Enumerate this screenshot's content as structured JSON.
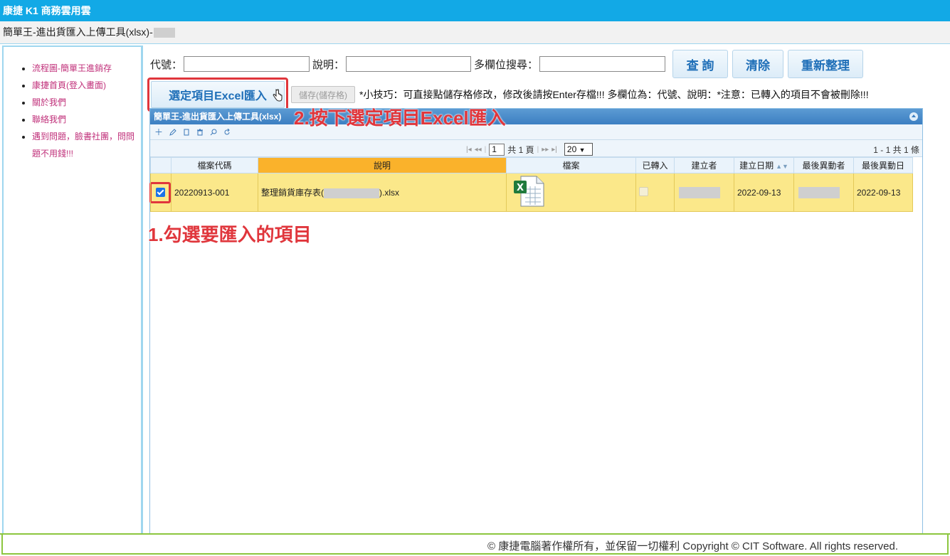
{
  "app": {
    "title": "康捷 K1 商務雲用雲"
  },
  "page": {
    "subtitle": "簡單王-進出貨匯入上傳工具(xlsx)-"
  },
  "sidebar": {
    "items": [
      {
        "label": "流程圖-簡單王進銷存"
      },
      {
        "label": "康捷首頁(登入畫面)"
      },
      {
        "label": "關於我們"
      },
      {
        "label": "聯絡我們"
      },
      {
        "label": "遇到問題，臉書社團，問問題不用錢!!!"
      }
    ]
  },
  "search": {
    "code_label": "代號：",
    "code_value": "",
    "desc_label": "說明：",
    "desc_value": "",
    "multi_label": "多欄位搜尋：",
    "multi_value": "",
    "query_button": "查 詢",
    "clear_button": "清除",
    "refresh_button": "重新整理"
  },
  "actions": {
    "excel_import_button": "選定項目Excel匯入",
    "save_button": "儲存(儲存格)",
    "tip": "*小技巧：可直接點儲存格修改，修改後請按Enter存檔!!! 多欄位為：代號、說明：*注意：已轉入的項目不會被刪除!!!"
  },
  "grid": {
    "caption": "簡單王-進出貨匯入上傳工具(xlsx)",
    "pager": {
      "page": "1",
      "total_pages_text": "共 1 頁",
      "page_size": "20",
      "record_count_text": "1 - 1 共 1 條"
    },
    "columns": [
      "檔案代碼",
      "說明",
      "檔案",
      "已轉入",
      "建立者",
      "建立日期",
      "最後異動者",
      "最後異動日"
    ],
    "rows": [
      {
        "code": "20220913-001",
        "desc_prefix": "整理銷貨庫存表(",
        "desc_suffix": ").xlsx",
        "file_icon": "excel-file-icon",
        "imported": false,
        "created_date": "2022-09-13",
        "modified_date": "2022-09-13",
        "selected": true
      }
    ]
  },
  "annotations": {
    "step1": "1.勾選要匯入的項目",
    "step2": "2.按下選定項目Excel匯入"
  },
  "footer": {
    "copyright": "© 康捷電腦著作權所有，並保留一切權利 Copyright © CIT Software. All rights reserved."
  },
  "colors": {
    "topbar": "#12a9e6",
    "accent_red": "#e0363c",
    "row_highlight": "#fbe88a",
    "sorted_header": "#fab22b"
  }
}
